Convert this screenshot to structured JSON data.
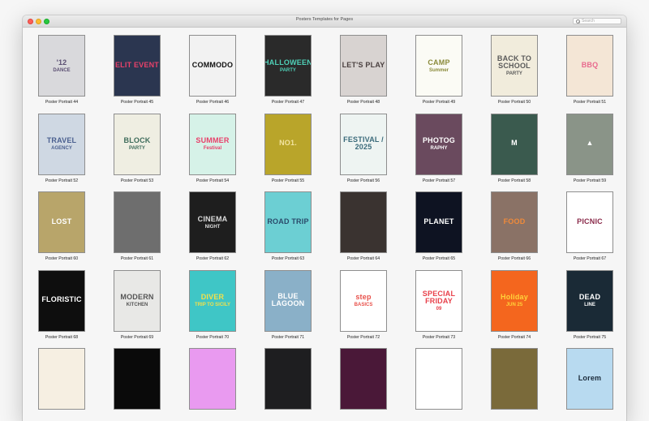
{
  "window": {
    "title": "Posters Templates for Pages",
    "controls": [
      "close",
      "minimize",
      "zoom"
    ]
  },
  "search": {
    "placeholder": "Search",
    "value": "",
    "icon": "search-icon"
  },
  "templates": [
    {
      "label": "Poster Portrait 44",
      "bg": "#d9d9dc",
      "fg": "#5b4f72",
      "t1": "'12",
      "t2": "DANCE"
    },
    {
      "label": "Poster Portrait 45",
      "bg": "#2b3650",
      "fg": "#e8416a",
      "t1": "ELIT EVENT",
      "t2": ""
    },
    {
      "label": "Poster Portrait 46",
      "bg": "#f2f2f2",
      "fg": "#111111",
      "t1": "COMMODO",
      "t2": ""
    },
    {
      "label": "Poster Portrait 47",
      "bg": "#2a2a2a",
      "fg": "#4fd1b8",
      "t1": "HALLOWEEN",
      "t2": "PARTY"
    },
    {
      "label": "Poster Portrait 48",
      "bg": "#d8d3d1",
      "fg": "#4a4040",
      "t1": "LET'S PLAY",
      "t2": ""
    },
    {
      "label": "Poster Portrait 49",
      "bg": "#fbfbf5",
      "fg": "#8a8a3a",
      "t1": "CAMP",
      "t2": "Summer"
    },
    {
      "label": "Poster Portrait 50",
      "bg": "#f1ecdc",
      "fg": "#5a5a5a",
      "t1": "BACK TO SCHOOL",
      "t2": "PARTY"
    },
    {
      "label": "Poster Portrait 51",
      "bg": "#f4e6d6",
      "fg": "#e86a8e",
      "t1": "BBQ",
      "t2": ""
    },
    {
      "label": "Poster Portrait 52",
      "bg": "#cfd8e3",
      "fg": "#4a5f8f",
      "t1": "TRAVEL",
      "t2": "AGENCY"
    },
    {
      "label": "Poster Portrait 53",
      "bg": "#efeee2",
      "fg": "#3d6b5a",
      "t1": "BLOCK",
      "t2": "PARTY"
    },
    {
      "label": "Poster Portrait 54",
      "bg": "#d6f2e8",
      "fg": "#e8406a",
      "t1": "SUMMER",
      "t2": "Festival"
    },
    {
      "label": "Poster Portrait 55",
      "bg": "#b9a52a",
      "fg": "#f2e3a0",
      "t1": "NO1.",
      "t2": ""
    },
    {
      "label": "Poster Portrait 56",
      "bg": "#eef4f2",
      "fg": "#3a6a7a",
      "t1": "FESTIVAL / 2025",
      "t2": ""
    },
    {
      "label": "Poster Portrait 57",
      "bg": "#6a4a5e",
      "fg": "#ffffff",
      "t1": "PHOTOG",
      "t2": "RAPHY"
    },
    {
      "label": "Poster Portrait 58",
      "bg": "#3a5a4e",
      "fg": "#ffffff",
      "t1": "M",
      "t2": ""
    },
    {
      "label": "Poster Portrait 59",
      "bg": "#8a9488",
      "fg": "#ffffff",
      "t1": "▲",
      "t2": ""
    },
    {
      "label": "Poster Portrait 60",
      "bg": "#b8a56a",
      "fg": "#ffffff",
      "t1": "LOST",
      "t2": ""
    },
    {
      "label": "Poster Portrait 61",
      "bg": "#6e6e6e",
      "fg": "#ffffff",
      "t1": "",
      "t2": ""
    },
    {
      "label": "Poster Portrait 62",
      "bg": "#1e1e1e",
      "fg": "#dddddd",
      "t1": "CINEMA",
      "t2": "NIGHT"
    },
    {
      "label": "Poster Portrait 63",
      "bg": "#6ccfd3",
      "fg": "#2a4a6a",
      "t1": "ROAD TRIP",
      "t2": ""
    },
    {
      "label": "Poster Portrait 64",
      "bg": "#3a3330",
      "fg": "#ffffff",
      "t1": "",
      "t2": ""
    },
    {
      "label": "Poster Portrait 65",
      "bg": "#0e1322",
      "fg": "#ffffff",
      "t1": "PLANET",
      "t2": ""
    },
    {
      "label": "Poster Portrait 66",
      "bg": "#8a7266",
      "fg": "#f08a3a",
      "t1": "FOOD",
      "t2": ""
    },
    {
      "label": "Poster Portrait 67",
      "bg": "#ffffff",
      "fg": "#8a2a4a",
      "t1": "PICNIC",
      "t2": ""
    },
    {
      "label": "Poster Portrait 68",
      "bg": "#0e0e0e",
      "fg": "#ffffff",
      "t1": "FLORISTIC",
      "t2": ""
    },
    {
      "label": "Poster Portrait 69",
      "bg": "#e8e8e6",
      "fg": "#555555",
      "t1": "MODERN",
      "t2": "KITCHEN"
    },
    {
      "label": "Poster Portrait 70",
      "bg": "#3fc6c6",
      "fg": "#f2e04a",
      "t1": "DIVER",
      "t2": "TRIP TO SICILY"
    },
    {
      "label": "Poster Portrait 71",
      "bg": "#8ab0c8",
      "fg": "#ffffff",
      "t1": "BLUE LAGOON",
      "t2": ""
    },
    {
      "label": "Poster Portrait 72",
      "bg": "#ffffff",
      "fg": "#e8504a",
      "t1": "step",
      "t2": "BASICS"
    },
    {
      "label": "Poster Portrait 73",
      "bg": "#ffffff",
      "fg": "#e8404a",
      "t1": "SPECIAL FRIDAY",
      "t2": "09"
    },
    {
      "label": "Poster Portrait 74",
      "bg": "#f4661e",
      "fg": "#ffd23a",
      "t1": "Holiday",
      "t2": "JUN 25"
    },
    {
      "label": "Poster Portrait 75",
      "bg": "#1a2a36",
      "fg": "#ffffff",
      "t1": "DEAD",
      "t2": "LINE"
    },
    {
      "label": "",
      "bg": "#f6efe2",
      "fg": "#e8605a",
      "t1": "",
      "t2": ""
    },
    {
      "label": "",
      "bg": "#0a0a0a",
      "fg": "#cccccc",
      "t1": "",
      "t2": ""
    },
    {
      "label": "",
      "bg": "#e99af0",
      "fg": "#2ad6a0",
      "t1": "",
      "t2": ""
    },
    {
      "label": "",
      "bg": "#1e1e20",
      "fg": "#cccccc",
      "t1": "",
      "t2": ""
    },
    {
      "label": "",
      "bg": "#4a1838",
      "fg": "#e8c890",
      "t1": "",
      "t2": ""
    },
    {
      "label": "",
      "bg": "#ffffff",
      "fg": "#555555",
      "t1": "",
      "t2": ""
    },
    {
      "label": "",
      "bg": "#7a6a3a",
      "fg": "#ffffff",
      "t1": "",
      "t2": ""
    },
    {
      "label": "",
      "bg": "#b8daf0",
      "fg": "#1a2a3a",
      "t1": "Lorem",
      "t2": ""
    }
  ]
}
